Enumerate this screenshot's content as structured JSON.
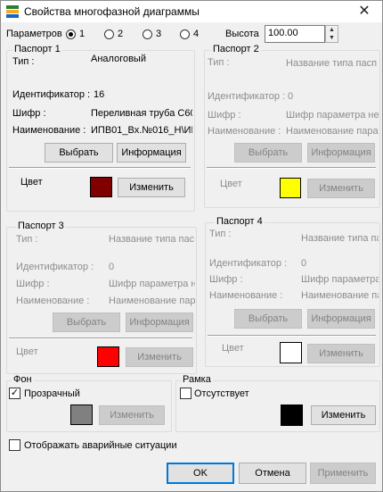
{
  "window": {
    "title": "Свойства многофазной диаграммы",
    "close_glyph": "✕",
    "icon": "chart-app-icon"
  },
  "params": {
    "label": "Параметров",
    "options": [
      "1",
      "2",
      "3",
      "4"
    ],
    "selected": "1",
    "height_label": "Высота",
    "height_value": "100.00"
  },
  "passports": [
    {
      "title": "Паспорт 1",
      "type_label": "Тип :",
      "type_value": "Аналоговый",
      "id_label": "Идентификатор :",
      "id_value": "16",
      "cipher_label": "Шифр :",
      "cipher_value": "Переливная труба С60",
      "name_label": "Наименование :",
      "name_value": "ИПВ01_Вх.№016_Н\\ИГ",
      "select_label": "Выбрать",
      "info_label": "Информация",
      "color_label": "Цвет",
      "color": "#800000",
      "change_label": "Изменить"
    },
    {
      "title": "Паспорт 2",
      "type_label": "Тип :",
      "type_value": "Название типа пасп",
      "id_label": "Идентификатор :",
      "id_value": "0",
      "cipher_label": "Шифр :",
      "cipher_value": "Шифр параметра не",
      "name_label": "Наименование :",
      "name_value": "Наименование пара",
      "select_label": "Выбрать",
      "info_label": "Информация",
      "color_label": "Цвет",
      "color": "#ffff00",
      "change_label": "Изменить"
    },
    {
      "title": "Паспорт 3",
      "type_label": "Тип :",
      "type_value": "Название типа пас",
      "id_label": "Идентификатор :",
      "id_value": "0",
      "cipher_label": "Шифр :",
      "cipher_value": "Шифр параметра н",
      "name_label": "Наименование :",
      "name_value": "Наименование пар",
      "select_label": "Выбрать",
      "info_label": "Информация",
      "color_label": "Цвет",
      "color": "#ff0000",
      "change_label": "Изменить"
    },
    {
      "title": "Паспорт 4",
      "type_label": "Тип :",
      "type_value": "Название типа пас",
      "id_label": "Идентификатор :",
      "id_value": "0",
      "cipher_label": "Шифр :",
      "cipher_value": "Шифр параметра",
      "name_label": "Наименование :",
      "name_value": "Наименование пар",
      "select_label": "Выбрать",
      "info_label": "Информация",
      "color_label": "Цвет",
      "color": "#ffffff",
      "change_label": "Изменить"
    }
  ],
  "background": {
    "title": "Фон",
    "transparent_label": "Прозрачный",
    "transparent_checked": true,
    "color": "#808080",
    "change_label": "Изменить"
  },
  "frame": {
    "title": "Рамка",
    "absent_label": "Отсутствует",
    "absent_checked": false,
    "color": "#000000",
    "change_label": "Изменить"
  },
  "alarm": {
    "label": "Отображать аварийные ситуации",
    "checked": false
  },
  "footer": {
    "ok": "OK",
    "cancel": "Отмена",
    "apply": "Применить"
  }
}
